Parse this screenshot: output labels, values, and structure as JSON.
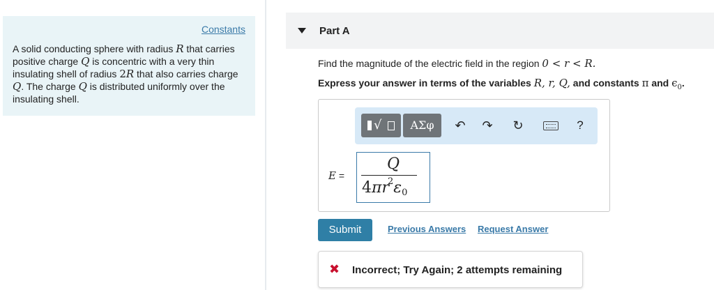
{
  "left_panel": {
    "constants_link": "Constants",
    "text_1": "A solid conducting sphere with radius ",
    "R_1": "R",
    "text_2": " that carries positive charge ",
    "Q_1": "Q",
    "text_3": " is concentric with a very thin insulating shell of radius ",
    "two": "2",
    "R_2": "R",
    "text_4": " that also carries charge ",
    "Q_2": "Q",
    "text_5": ". The charge ",
    "Q_3": "Q",
    "text_6": " is distributed uniformly over the insulating shell."
  },
  "part": {
    "title": "Part A",
    "question_text": "Find the magnitude of the electric field in the region ",
    "region": "0 < r < R.",
    "instructions_text": "Express your answer in terms of the variables ",
    "variables": "R, r, Q,",
    "and_constants": " and constants ",
    "pi": "π",
    "and": " and ",
    "epsilon": "ϵ",
    "eps_sub": "0",
    "end": "."
  },
  "toolbar": {
    "greek_label": "ΑΣφ",
    "undo_icon": "↶",
    "redo_icon": "↷",
    "reset_icon": "↻",
    "help_label": "?"
  },
  "answer": {
    "label_var": "E",
    "label_eq": " =",
    "numerator": "Q",
    "den_coeff": "4",
    "den_pi": "π",
    "den_r": "r",
    "den_exp": "2",
    "den_eps": "ε",
    "den_eps_sub": "0"
  },
  "actions": {
    "submit": "Submit",
    "previous_answers": "Previous Answers",
    "request_answer": "Request Answer"
  },
  "feedback": {
    "icon": "✖",
    "message": "Incorrect; Try Again; 2 attempts remaining",
    "color": "#c8102e"
  }
}
